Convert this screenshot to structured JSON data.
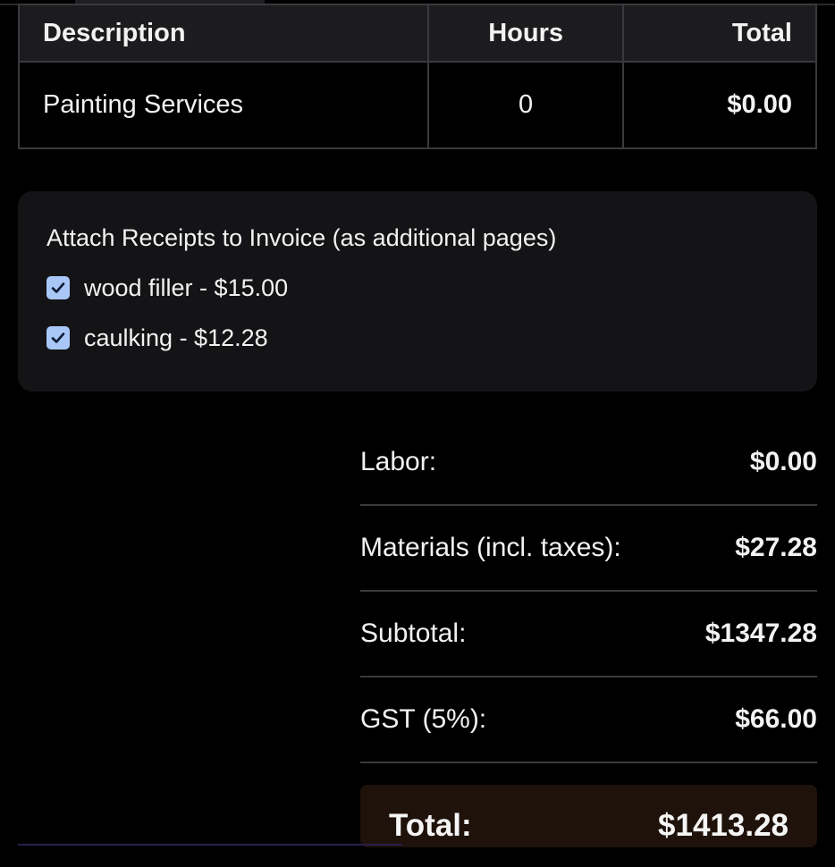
{
  "services_table": {
    "headers": {
      "description": "Description",
      "hours": "Hours",
      "total": "Total"
    },
    "rows": [
      {
        "description": "Painting Services",
        "hours": "0",
        "total": "$0.00"
      }
    ]
  },
  "receipts": {
    "title": "Attach Receipts to Invoice (as additional pages)",
    "items": [
      {
        "label": "wood filler - $15.00",
        "checked": true
      },
      {
        "label": "caulking - $12.28",
        "checked": true
      }
    ],
    "checkbox_color": "#a9c7f6"
  },
  "summary": {
    "rows": [
      {
        "label": "Labor:",
        "value": "$0.00"
      },
      {
        "label": "Materials (incl. taxes):",
        "value": "$27.28"
      },
      {
        "label": "Subtotal:",
        "value": "$1347.28"
      },
      {
        "label": "GST (5%):",
        "value": "$66.00"
      }
    ],
    "total": {
      "label": "Total:",
      "value": "$1413.28"
    }
  },
  "colors": {
    "background": "#000000",
    "card": "#141416",
    "total_box": "#1e120a"
  }
}
